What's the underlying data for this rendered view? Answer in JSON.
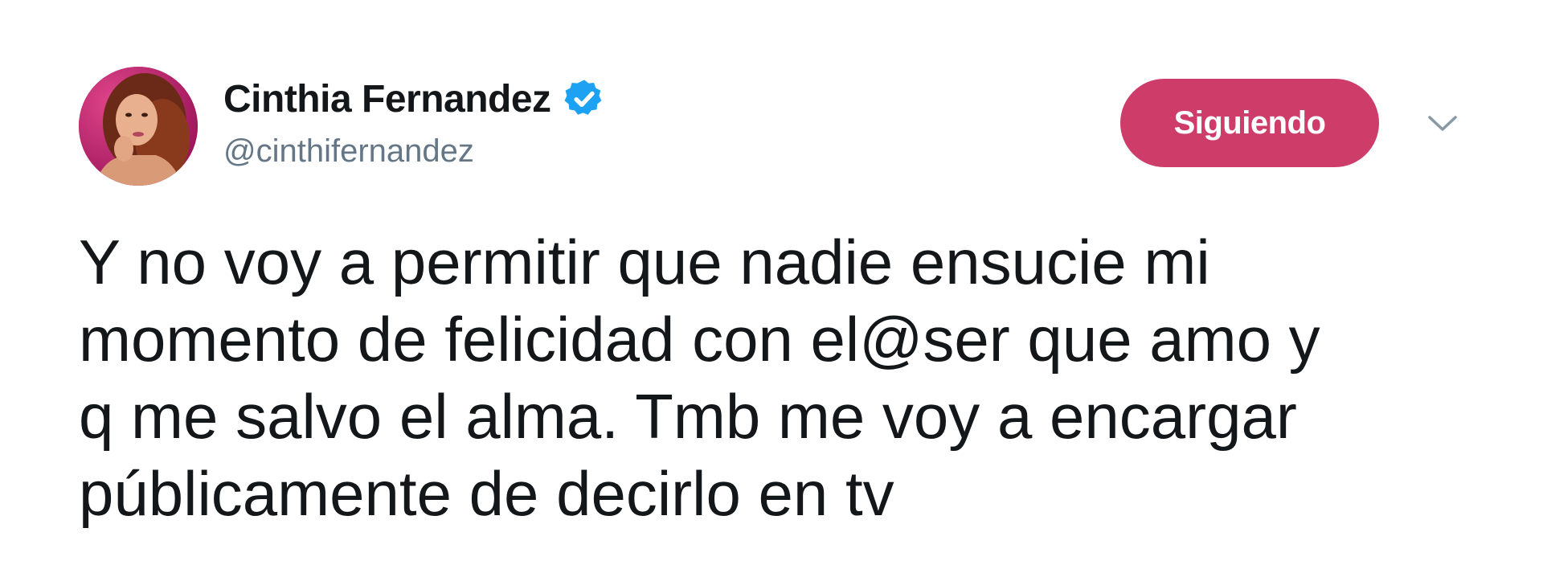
{
  "tweet": {
    "author": {
      "display_name": "Cinthia Fernandez",
      "handle": "@cinthifernandez",
      "verified": true,
      "avatar_icon": "profile-photo"
    },
    "follow_button_label": "Siguiendo",
    "menu_icon": "chevron-down-icon",
    "text_lines": [
      "Y no voy a permitir que nadie ensucie mi",
      "momento de felicidad con el@ser que amo y",
      "q me salvo el alma. Tmb me voy a encargar",
      "públicamente de decirlo en tv"
    ]
  },
  "colors": {
    "follow_button": "#ce3d6a",
    "verified_badge": "#1da1f2",
    "handle": "#657786",
    "text": "#14171a",
    "background": "#ffffff"
  }
}
